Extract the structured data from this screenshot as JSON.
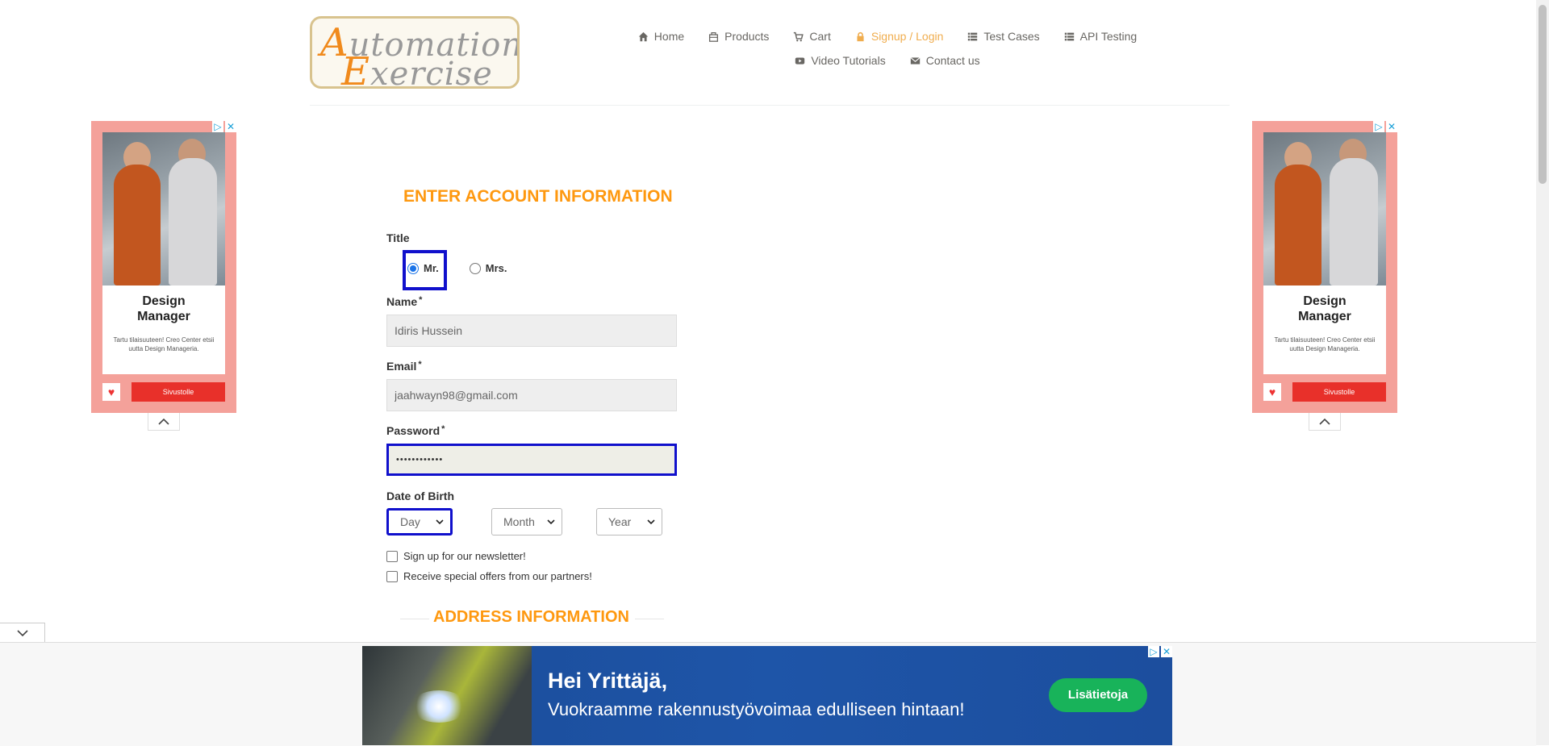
{
  "logo": {
    "line1_cap": "A",
    "line1_rest": "utomation",
    "line2_cap": "E",
    "line2_rest": "xercise"
  },
  "nav": {
    "row1": [
      {
        "label": "Home",
        "icon": "home-icon"
      },
      {
        "label": "Products",
        "icon": "products-icon"
      },
      {
        "label": "Cart",
        "icon": "cart-icon"
      },
      {
        "label": "Signup / Login",
        "icon": "lock-icon",
        "active": true
      },
      {
        "label": "Test Cases",
        "icon": "list-icon"
      },
      {
        "label": "API Testing",
        "icon": "list-icon"
      }
    ],
    "row2": [
      {
        "label": "Video Tutorials",
        "icon": "youtube-icon"
      },
      {
        "label": "Contact us",
        "icon": "envelope-icon"
      }
    ]
  },
  "side_ad": {
    "title_line1": "Design",
    "title_line2": "Manager",
    "desc": "Tartu tilaisuuteen! Creo Center etsii uutta Design Manageria.",
    "button": "Sivustolle",
    "close": "✕",
    "adchoices": "▷"
  },
  "form": {
    "heading": "ENTER ACCOUNT INFORMATION",
    "title_label": "Title",
    "title_options": [
      "Mr.",
      "Mrs."
    ],
    "title_selected": "Mr.",
    "name_label": "Name",
    "name_value": "Idiris Hussein",
    "email_label": "Email",
    "email_value": "jaahwayn98@gmail.com",
    "password_label": "Password",
    "password_value": "••••••••••••",
    "required_mark": "*",
    "dob_label": "Date of Birth",
    "dob_day": "Day",
    "dob_month": "Month",
    "dob_year": "Year",
    "newsletter_label": "Sign up for our newsletter!",
    "offers_label": "Receive special offers from our partners!",
    "address_heading": "ADDRESS INFORMATION"
  },
  "banner": {
    "headline": "Hei Yrittäjä,",
    "subline": "Vuokraamme rakennustyövoimaa edulliseen hintaan!",
    "button": "Lisätietoja"
  },
  "colors": {
    "accent": "#fe980f",
    "focus": "#1010cc",
    "banner_bg": "#1e55a8",
    "banner_btn": "#18b35a"
  }
}
